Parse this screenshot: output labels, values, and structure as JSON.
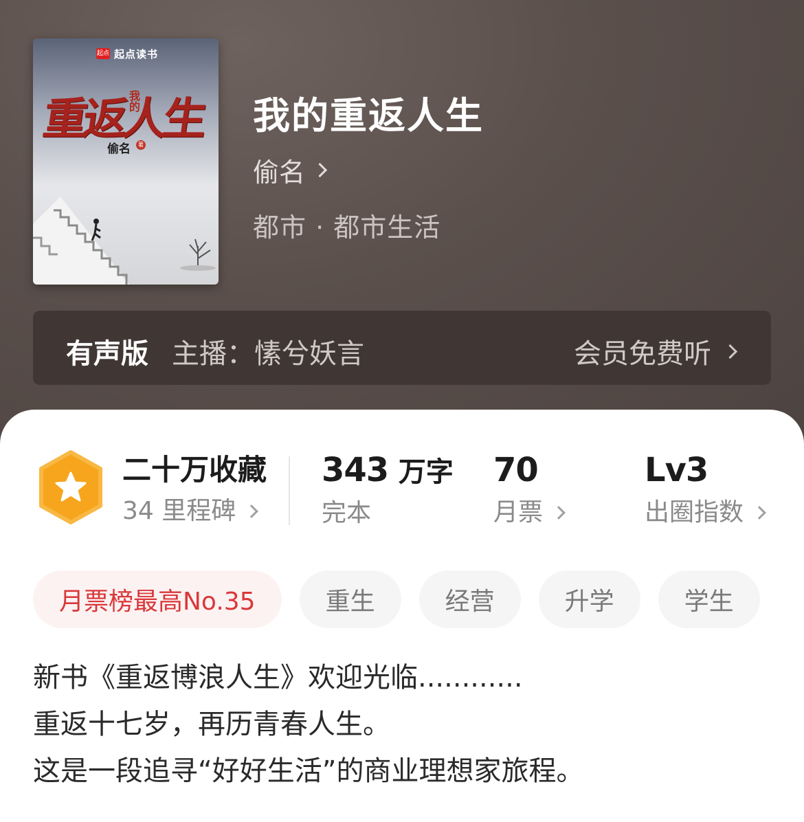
{
  "book": {
    "title": "我的重返人生",
    "author": "偷名",
    "genre": "都市 · 都市生活"
  },
  "cover": {
    "brand": "起点读书",
    "logo_text": "起点",
    "title_main": "重返人生",
    "title_small": "我的",
    "author": "偷名",
    "author_mark": "著"
  },
  "audio": {
    "label": "有声版",
    "host": "主播：愫兮妖言",
    "action": "会员免费听"
  },
  "stats": {
    "collect_main": "二十万收藏",
    "collect_sub": "34 里程碑",
    "words_num": "343",
    "words_unit": "万字",
    "words_sub": "完本",
    "votes_num": "70",
    "votes_sub": "月票",
    "level_num": "Lv3",
    "level_sub": "出圈指数"
  },
  "tags": [
    "月票榜最高No.35",
    "重生",
    "经营",
    "升学",
    "学生"
  ],
  "description": [
    "新书《重返博浪人生》欢迎光临............",
    "重返十七岁，再历青春人生。",
    "这是一段追寻“好好生活”的商业理想家旅程。"
  ],
  "colors": {
    "hero_bg": "#574b48",
    "accent_red": "#d9383a",
    "badge_orange": "#f5a623"
  }
}
